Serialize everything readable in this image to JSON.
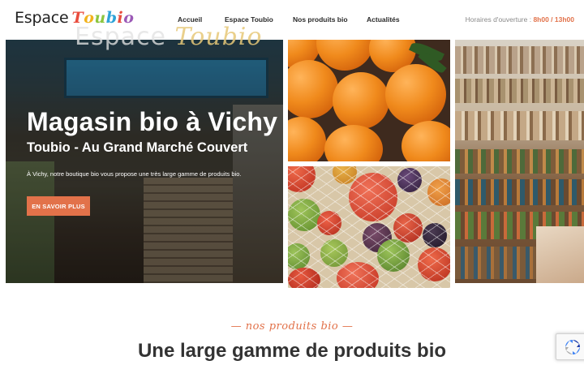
{
  "logo": {
    "word": "Espace",
    "brand_letters": [
      "T",
      "o",
      "u",
      "b",
      "i",
      "o"
    ],
    "brand_colors": [
      "#e94c3d",
      "#f2b21b",
      "#8cc63f",
      "#2ea3d8",
      "#e94c3d",
      "#9b59b6"
    ]
  },
  "nav": {
    "items": [
      "Accueil",
      "Espace Toubio",
      "Nos produits bio",
      "Actualités"
    ],
    "active_index": 0
  },
  "hours": {
    "label": "Horaires d'ouverture : ",
    "time": "8h00 / 13h00"
  },
  "hero": {
    "sign_word": "Espace",
    "sign_brand": "Toubio",
    "title": "Magasin bio à Vichy",
    "subtitle": "Toubio - Au Grand Marché Couvert",
    "text": "À Vichy, notre boutique bio vous propose une très large gamme de produits bio.",
    "button_label": "EN SAVOIR PLUS"
  },
  "section": {
    "tagline": "— nos produits bio —",
    "title": "Une large gamme de produits bio"
  },
  "colors": {
    "accent": "#e2724a",
    "text": "#222222",
    "muted": "#8a8a8a"
  },
  "icons": {
    "recaptcha": "recaptcha-icon"
  }
}
